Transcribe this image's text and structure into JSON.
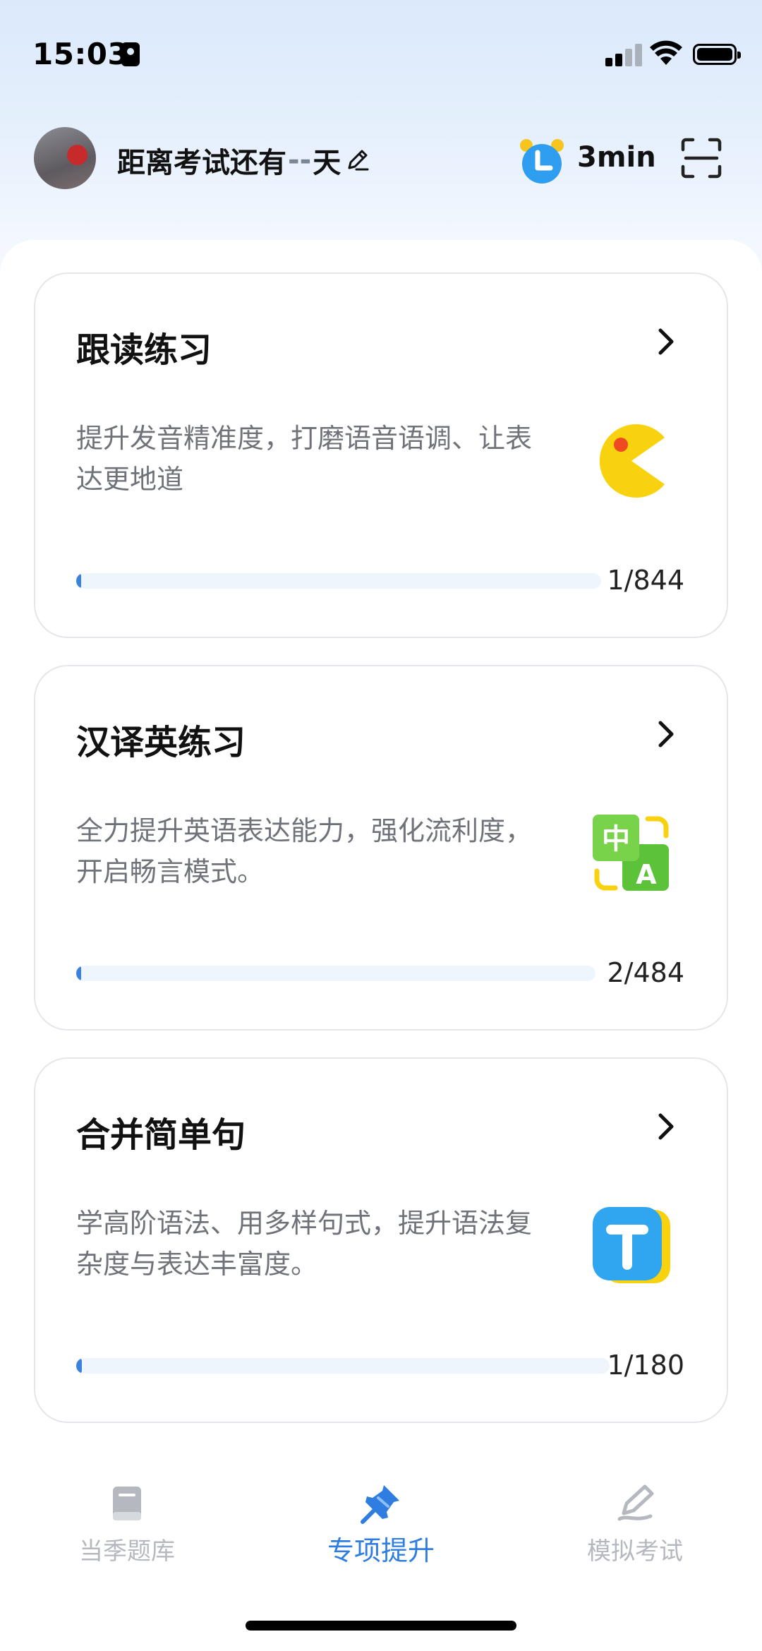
{
  "status_bar": {
    "time": "15:03"
  },
  "header": {
    "exam_countdown_prefix": "距离考试还有",
    "exam_countdown_value": "--",
    "exam_countdown_suffix": "天",
    "study_time": "3min"
  },
  "cards": [
    {
      "title": "跟读练习",
      "description": "提升发音精准度，打磨语音语调、让表达更地道",
      "progress_text": "1/844",
      "progress_fraction": 0.0012,
      "icon": "pacman-icon"
    },
    {
      "title": "汉译英练习",
      "description": "全力提升英语表达能力，强化流利度，开启畅言模式。",
      "progress_text": "2/484",
      "progress_fraction": 0.0041,
      "icon": "translate-icon"
    },
    {
      "title": "合并简单句",
      "description": "学高阶语法、用多样句式，提升语法复杂度与表达丰富度。",
      "progress_text": "1/180",
      "progress_fraction": 0.0056,
      "icon": "t-letter-icon"
    }
  ],
  "bottom_nav": {
    "items": [
      {
        "label": "当季题库",
        "icon": "book-icon",
        "active": false
      },
      {
        "label": "专项提升",
        "icon": "pin-icon",
        "active": true
      },
      {
        "label": "模拟考试",
        "icon": "pen-icon",
        "active": false
      }
    ]
  },
  "colors": {
    "accent": "#2f7de1",
    "inactive": "#b5b9bf",
    "description": "#6f7379",
    "progress_track": "#eef5fd"
  }
}
